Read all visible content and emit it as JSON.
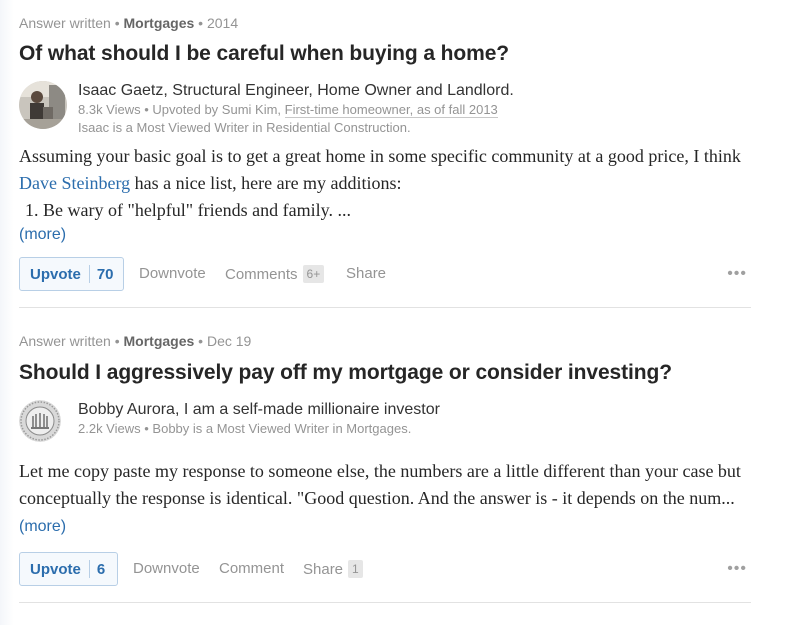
{
  "stories": [
    {
      "meta": {
        "prefix": "Answer written",
        "sep1": " • ",
        "topic": "Mortgages",
        "sep2": " • ",
        "date": "2014"
      },
      "question": "Of what should I be careful when buying a home?",
      "author": {
        "avatar_icon": "person-photo-icon",
        "name_line": "Isaac Gaetz, Structural Engineer, Home Owner and Landlord.",
        "views": "8.3k Views",
        "upvoted_prefix": " • Upvoted by Sumi Kim, ",
        "upvoter_cred": "First-time homeowner, as of fall 2013",
        "most_viewed": "Isaac is a Most Viewed Writer in Residential Construction."
      },
      "body": {
        "line1_a": "Assuming your basic goal is to get a great home in some specific community at a good price, I think ",
        "link": "Dave Steinberg",
        "line1_b": " has a nice list, here are my additions:",
        "list_item": "1.  Be wary of \"helpful\" friends and family. ...",
        "more": "(more)"
      },
      "actions": {
        "upvote": "Upvote",
        "upvote_count": "70",
        "downvote": "Downvote",
        "comments": "Comments",
        "comments_count": "6+",
        "share": "Share",
        "more": "•••"
      }
    },
    {
      "meta": {
        "prefix": "Answer written",
        "sep1": " • ",
        "topic": "Mortgages",
        "sep2": " • ",
        "date": "Dec 19"
      },
      "question": "Should I aggressively pay off my mortgage or consider investing?",
      "author": {
        "avatar_icon": "coin-seal-icon",
        "name_line": "Bobby Aurora, I am a self-made millionaire investor",
        "views": "2.2k Views",
        "most_viewed": " • Bobby is a Most Viewed Writer in Mortgages."
      },
      "body": {
        "text": "Let me copy paste my response to someone else, the numbers are a little different than your case but conceptually the response is identical. \"Good question. And the answer is - it depends on the num... ",
        "more": "(more)"
      },
      "actions": {
        "upvote": "Upvote",
        "upvote_count": "6",
        "downvote": "Downvote",
        "comment": "Comment",
        "share": "Share",
        "share_count": "1",
        "more": "•••"
      }
    }
  ],
  "colors": {
    "link": "#2b6dad",
    "muted": "#949494",
    "title": "#262626",
    "divider": "#e2e2e2"
  }
}
